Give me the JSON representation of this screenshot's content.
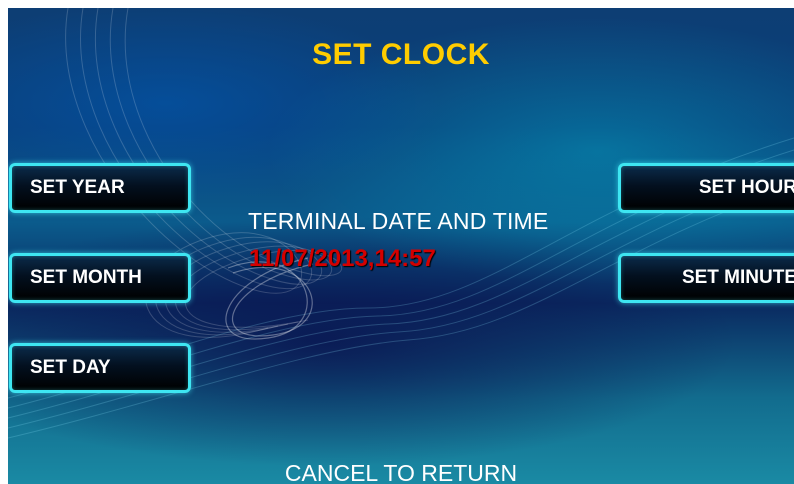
{
  "screen": {
    "title": "SET CLOCK",
    "title_color": "#ffcc00",
    "accent_color": "#3ee6f2"
  },
  "left_buttons": [
    {
      "label": "SET YEAR"
    },
    {
      "label": "SET MONTH"
    },
    {
      "label": "SET DAY"
    }
  ],
  "right_buttons": [
    {
      "label": "SET HOUR"
    },
    {
      "label": "SET MINUTE"
    }
  ],
  "info": {
    "label": "TERMINAL DATE AND TIME",
    "value": "11/07/2013,14:57",
    "value_color": "#d40000"
  },
  "footer": {
    "cancel_label": "CANCEL TO RETURN"
  }
}
